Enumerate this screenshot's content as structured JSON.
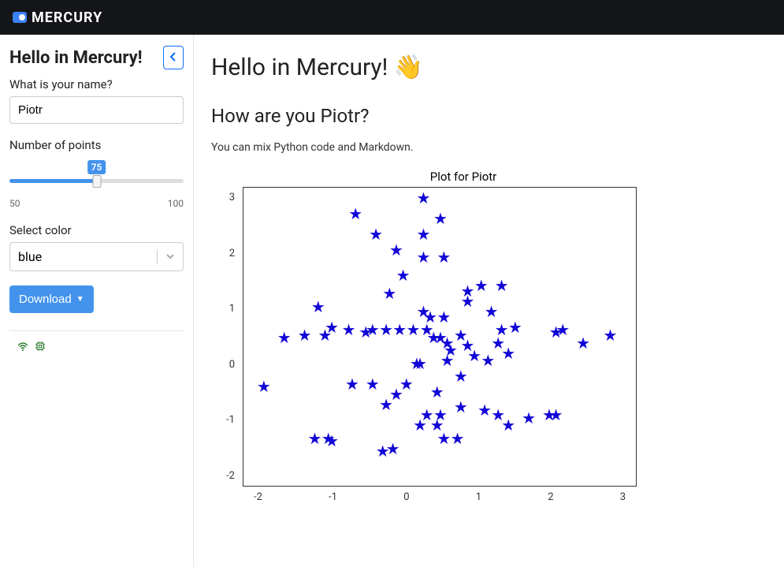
{
  "brand": "MERCURY",
  "sidebar": {
    "title": "Hello in Mercury!",
    "name_label": "What is your name?",
    "name_value": "Piotr",
    "points_label": "Number of points",
    "points_value": "75",
    "points_min": "50",
    "points_max": "100",
    "color_label": "Select color",
    "color_value": "blue",
    "download_label": "Download"
  },
  "main": {
    "heading": "Hello in Mercury! 👋",
    "subheading": "How are you Piotr?",
    "body": "You can mix Python code and Markdown."
  },
  "chart_data": {
    "type": "scatter",
    "title": "Plot for Piotr",
    "xlabel": "",
    "ylabel": "",
    "xlim": [
      -2.6,
      3.2
    ],
    "ylim": [
      -2.5,
      3.3
    ],
    "xticks": [
      "-2",
      "-1",
      "0",
      "1",
      "2",
      "3"
    ],
    "yticks": [
      "3",
      "2",
      "1",
      "0",
      "-1",
      "-2"
    ],
    "marker": "star",
    "color": "blue",
    "series": [
      {
        "name": "points",
        "x": [
          0.05,
          0.3,
          0.05,
          -0.65,
          -0.35,
          0.05,
          0.35,
          -0.45,
          0.7,
          0.7,
          0.9,
          1.05,
          1.2,
          1.2,
          -1.5,
          -0.95,
          -0.25,
          -1.05,
          -1.3,
          -0.7,
          -0.5,
          -0.3,
          -0.1,
          0.1,
          0.05,
          0.15,
          0.35,
          0.2,
          0.3,
          0.4,
          0.45,
          0.4,
          0.6,
          0.7,
          0.8,
          1.0,
          1.15,
          1.3,
          1.4,
          2.0,
          2.1,
          2.8,
          -2.3,
          -2.0,
          -1.7,
          -1.4,
          -0.8,
          -1.0,
          -0.7,
          -0.5,
          -0.35,
          -0.2,
          -0.05,
          0.0,
          0.0,
          0.1,
          0.25,
          0.35,
          0.25,
          0.3,
          0.6,
          0.6,
          0.55,
          0.95,
          1.15,
          1.3,
          1.6,
          1.9,
          2.0,
          2.4,
          -1.55,
          -1.35,
          -1.3,
          -0.55,
          -0.4
        ],
        "y": [
          3.1,
          2.7,
          2.4,
          2.4,
          2.1,
          1.95,
          1.95,
          1.25,
          1.3,
          1.1,
          1.4,
          0.9,
          1.4,
          0.55,
          1.0,
          2.8,
          1.6,
          0.55,
          0.6,
          0.55,
          0.55,
          0.55,
          0.55,
          0.55,
          0.9,
          0.8,
          0.8,
          0.4,
          0.4,
          0.3,
          0.15,
          -0.05,
          0.45,
          0.25,
          0.05,
          -0.05,
          0.3,
          0.1,
          0.6,
          0.5,
          0.55,
          0.45,
          -0.55,
          0.4,
          0.45,
          0.45,
          0.5,
          -0.5,
          -0.5,
          -0.9,
          -0.7,
          -0.5,
          -0.1,
          -0.1,
          -1.3,
          -1.1,
          -1.3,
          -1.55,
          -0.65,
          -1.1,
          -0.95,
          -0.35,
          -1.55,
          -1.0,
          -1.1,
          -1.3,
          -1.15,
          -1.1,
          -1.1,
          0.3,
          -1.55,
          -1.55,
          -1.6,
          -1.8,
          -1.75
        ]
      }
    ]
  }
}
